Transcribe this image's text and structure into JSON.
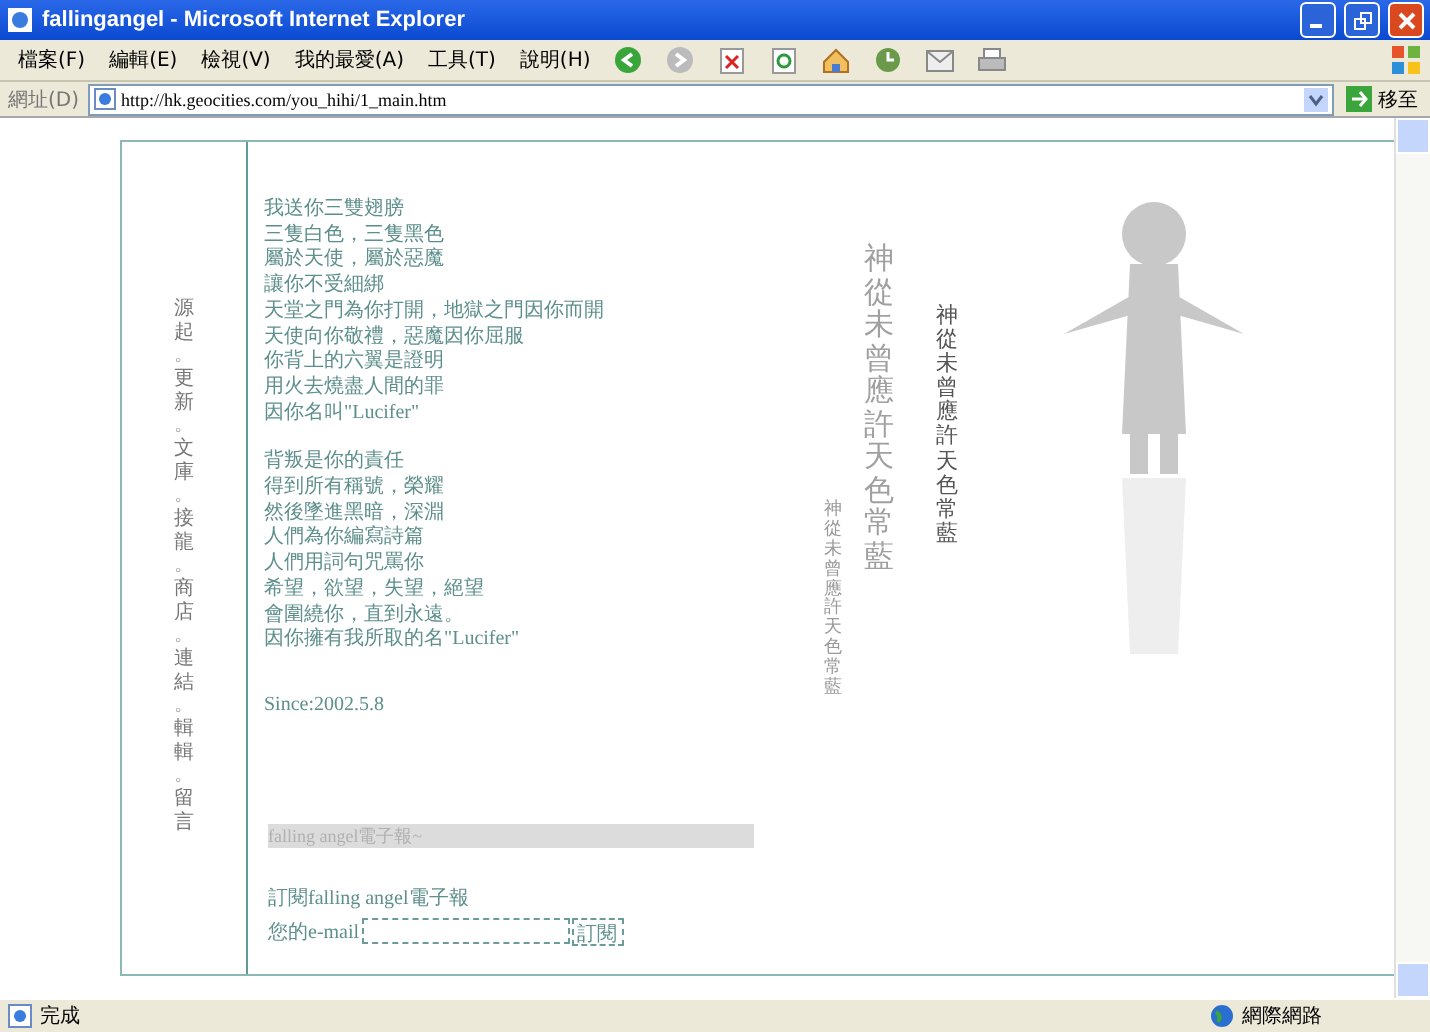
{
  "window": {
    "title": "fallingangel - Microsoft Internet Explorer"
  },
  "menu": [
    "檔案(F)",
    "編輯(E)",
    "檢視(V)",
    "我的最愛(A)",
    "工具(T)",
    "說明(H)"
  ],
  "address": {
    "label": "網址(D)",
    "value": "http://hk.geocities.com/you_hihi/1_main.htm",
    "go": "移至"
  },
  "nav": [
    {
      "kind": "link",
      "text": "源起"
    },
    {
      "kind": "sep",
      "text": "。"
    },
    {
      "kind": "link",
      "text": "更新"
    },
    {
      "kind": "sep",
      "text": "。"
    },
    {
      "kind": "link",
      "text": "文庫"
    },
    {
      "kind": "sep",
      "text": "。"
    },
    {
      "kind": "link",
      "text": "接龍"
    },
    {
      "kind": "sep",
      "text": "。"
    },
    {
      "kind": "link",
      "text": "商店"
    },
    {
      "kind": "sep",
      "text": "。"
    },
    {
      "kind": "link",
      "text": "連結"
    },
    {
      "kind": "sep",
      "text": "。"
    },
    {
      "kind": "link",
      "text": "輯輯"
    },
    {
      "kind": "sep",
      "text": "。"
    },
    {
      "kind": "link",
      "text": "留言"
    }
  ],
  "poem": [
    [
      "我送你三雙翅膀",
      "三隻白色，三隻黑色",
      "屬於天使，屬於惡魔",
      "讓你不受細綁",
      "天堂之門為你打開，地獄之門因你而開",
      "天使向你敬禮，惡魔因你屈服",
      "你背上的六翼是證明",
      "用火去燒盡人間的罪",
      "因你名叫\"Lucifer\""
    ],
    [
      "背叛是你的責任",
      "得到所有稱號，榮耀",
      "然後墜進黑暗，深淵",
      "人們為你編寫詩篇",
      "人們用詞句咒罵你",
      "希望，欲望，失望，絕望",
      "會圍繞你，直到永遠。",
      "因你擁有我所取的名\"Lucifer\""
    ]
  ],
  "since": "Since:2002.5.8",
  "marquee": "falling angel電子報~",
  "subscribe": {
    "title": "訂閱falling angel電子報",
    "label": "您的e-mail",
    "button": "訂閱"
  },
  "art_texts": [
    "神從未曾應許天色常藍",
    "神從未曾應許天色常藍",
    "神從未曾應許天色常藍"
  ],
  "status": {
    "text": "完成",
    "zone": "網際網路"
  }
}
